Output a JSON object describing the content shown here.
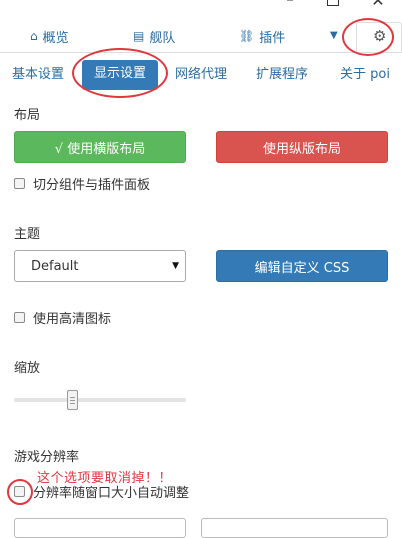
{
  "window": {
    "minimize_icon": "minimize-icon",
    "maximize_icon": "maximize-icon",
    "close_icon": "close-icon"
  },
  "topnav": {
    "tabs": [
      {
        "icon": "home-icon",
        "glyph": "⌂",
        "label": "概览"
      },
      {
        "icon": "list-icon",
        "glyph": "▤",
        "label": "舰队"
      },
      {
        "icon": "sitemap-icon",
        "glyph": "⛓",
        "label": "插件"
      }
    ],
    "dropdown_icon": "caret-down-icon",
    "settings_icon": "gear-icon"
  },
  "subtabs": [
    "基本设置",
    "显示设置",
    "网络代理",
    "扩展程序",
    "关于 poi"
  ],
  "active_subtab": "显示设置",
  "layout": {
    "heading": "布局",
    "horizontal_button": "√ 使用横版布局",
    "vertical_button": "使用纵版布局",
    "split_panel_checkbox": "切分组件与插件面板"
  },
  "theme": {
    "heading": "主题",
    "selected": "Default",
    "edit_css_button": "编辑自定义 CSS",
    "hd_icons_checkbox": "使用高清图标"
  },
  "zoom": {
    "heading": "缩放",
    "slider_value": 0.33
  },
  "resolution": {
    "heading": "游戏分辨率",
    "auto_adjust_checkbox": "分辨率随窗口大小自动调整",
    "annotation": "这个选项要取消掉！！"
  },
  "colors": {
    "accent": "#337ab7",
    "green": "#5cb85c",
    "red": "#d9534f",
    "annotation_red": "#e0383e"
  }
}
